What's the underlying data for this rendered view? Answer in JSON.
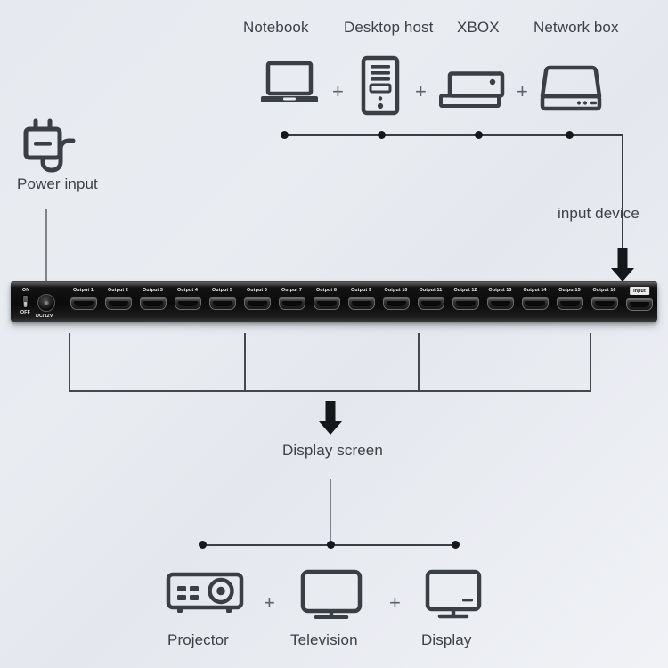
{
  "diagram": {
    "title": "HDMI splitter connection diagram",
    "background_colors": {
      "top_left": "#e6eaf0",
      "bottom_right": "#f0f2f6"
    },
    "line_color": "#3a3f45",
    "text_color": "#3c4147"
  },
  "input_sources": {
    "section_label": "input device",
    "separator": "+",
    "items": [
      {
        "label": "Notebook",
        "icon": "laptop-icon"
      },
      {
        "label": "Desktop host",
        "icon": "desktop-tower-icon"
      },
      {
        "label": "XBOX",
        "icon": "game-console-icon"
      },
      {
        "label": "Network box",
        "icon": "network-box-icon"
      }
    ]
  },
  "power": {
    "label": "Power input",
    "icon": "power-plug-icon"
  },
  "splitter": {
    "switch": {
      "on_label": "ON",
      "off_label": "OFF",
      "state": "OFF",
      "icon": "toggle-switch-icon"
    },
    "dc_jack": {
      "label": "DC/12V",
      "icon": "dc-power-jack-icon"
    },
    "output_ports": [
      "Output 1",
      "Output 2",
      "Output 3",
      "Output 4",
      "Output 5",
      "Output 6",
      "Output 7",
      "Output 8",
      "Output 9",
      "Output 10",
      "Output 11",
      "Output 12",
      "Output 13",
      "Output 14",
      "Output15",
      "Output 16"
    ],
    "input_port": {
      "label": "Input",
      "highlighted": true
    }
  },
  "outputs": {
    "section_label": "Display screen",
    "separator": "+",
    "items": [
      {
        "label": "Projector",
        "icon": "projector-icon"
      },
      {
        "label": "Television",
        "icon": "television-icon"
      },
      {
        "label": "Display",
        "icon": "monitor-icon"
      }
    ]
  },
  "arrows": {
    "input_arrow": "arrow-down-icon",
    "display_arrow": "arrow-down-icon"
  }
}
